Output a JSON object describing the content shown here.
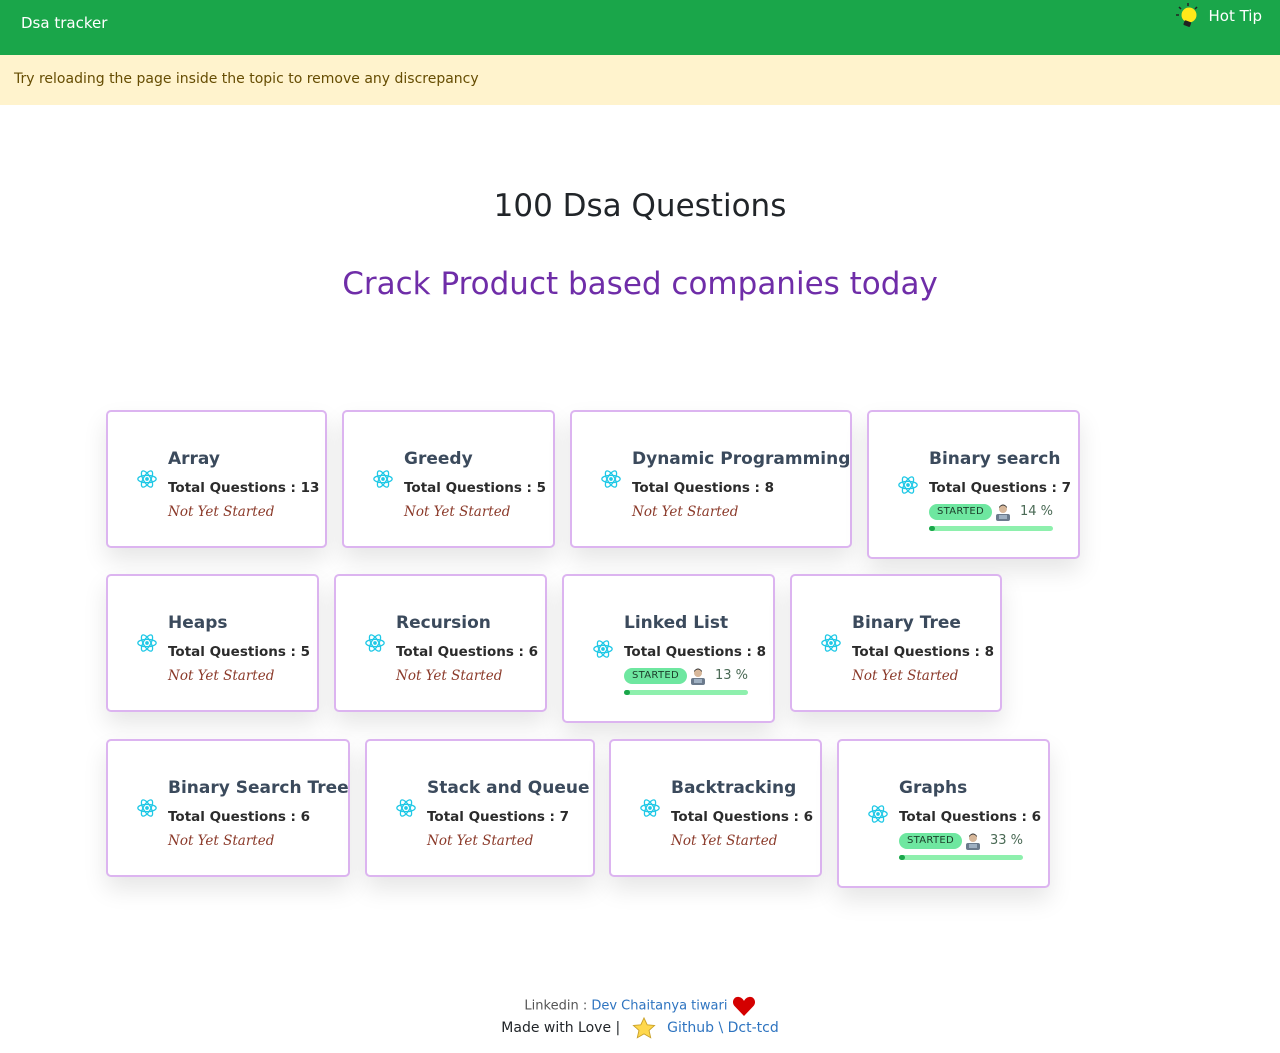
{
  "navbar": {
    "brand": "Dsa tracker",
    "hot_tip": "Hot Tip",
    "color": "#1aa64a"
  },
  "alert": {
    "text": "Try reloading the page inside the topic to remove any discrepancy"
  },
  "header": {
    "title": "100 Dsa Questions",
    "subtitle": "Crack Product based companies today",
    "subtitle_color": "#6f2da8"
  },
  "topics": [
    {
      "name": "Array",
      "count_label": "Total Questions : 13",
      "status": "Not Yet Started",
      "started": false
    },
    {
      "name": "Greedy",
      "count_label": "Total Questions : 5",
      "status": "Not Yet Started",
      "started": false
    },
    {
      "name": "Dynamic Programming",
      "count_label": "Total Questions : 8",
      "status": "Not Yet Started",
      "started": false
    },
    {
      "name": "Binary search",
      "count_label": "Total Questions : 7",
      "status": "STARTED",
      "started": true,
      "percent_label": "14 %",
      "progress": 0.14
    },
    {
      "name": "Heaps",
      "count_label": "Total Questions : 5",
      "status": "Not Yet Started",
      "started": false
    },
    {
      "name": "Recursion",
      "count_label": "Total Questions : 6",
      "status": "Not Yet Started",
      "started": false
    },
    {
      "name": "Linked List",
      "count_label": "Total Questions : 8",
      "status": "STARTED",
      "started": true,
      "percent_label": "13 %",
      "progress": 0.13
    },
    {
      "name": "Binary Tree",
      "count_label": "Total Questions : 8",
      "status": "Not Yet Started",
      "started": false
    },
    {
      "name": "Binary Search Tree",
      "count_label": "Total Questions : 6",
      "status": "Not Yet Started",
      "started": false
    },
    {
      "name": "Stack and Queue",
      "count_label": "Total Questions : 7",
      "status": "Not Yet Started",
      "started": false
    },
    {
      "name": "Backtracking",
      "count_label": "Total Questions : 6",
      "status": "Not Yet Started",
      "started": false
    },
    {
      "name": "Graphs",
      "count_label": "Total Questions : 6",
      "status": "STARTED",
      "started": true,
      "percent_label": "33 %",
      "progress": 0.33
    }
  ],
  "footer": {
    "linkedin_label": "Linkedin :",
    "linkedin_name": "Dev Chaitanya tiwari",
    "made_with_love": "Made with Love |",
    "github_label": "Github \\ Dct-tcd"
  }
}
